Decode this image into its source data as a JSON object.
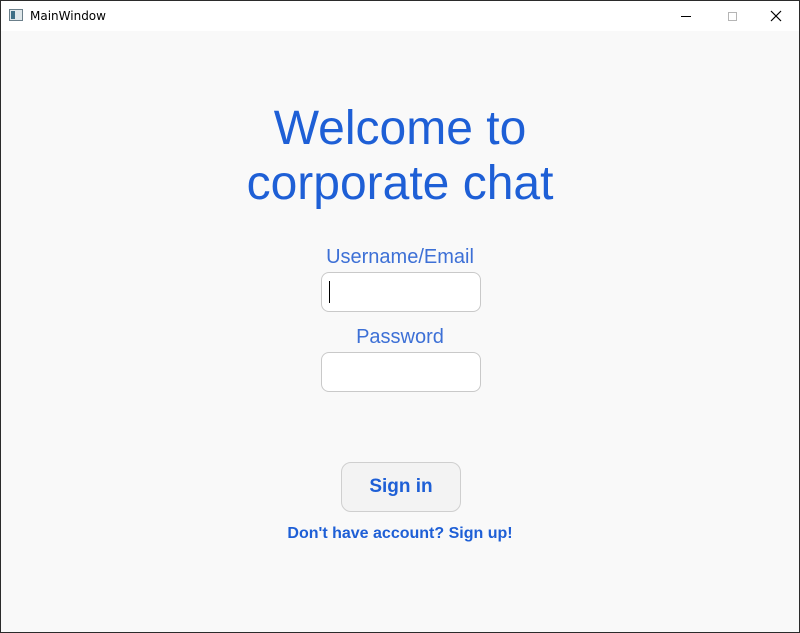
{
  "window": {
    "title": "MainWindow"
  },
  "header": {
    "line1": "Welcome to",
    "line2": "corporate chat"
  },
  "form": {
    "username_label": "Username/Email",
    "username_value": "",
    "password_label": "Password",
    "password_value": ""
  },
  "actions": {
    "signin_label": "Sign in",
    "signup_link": "Don't have account? Sign up!"
  },
  "colors": {
    "accent": "#1e5fd6",
    "background": "#f9f9f9"
  }
}
